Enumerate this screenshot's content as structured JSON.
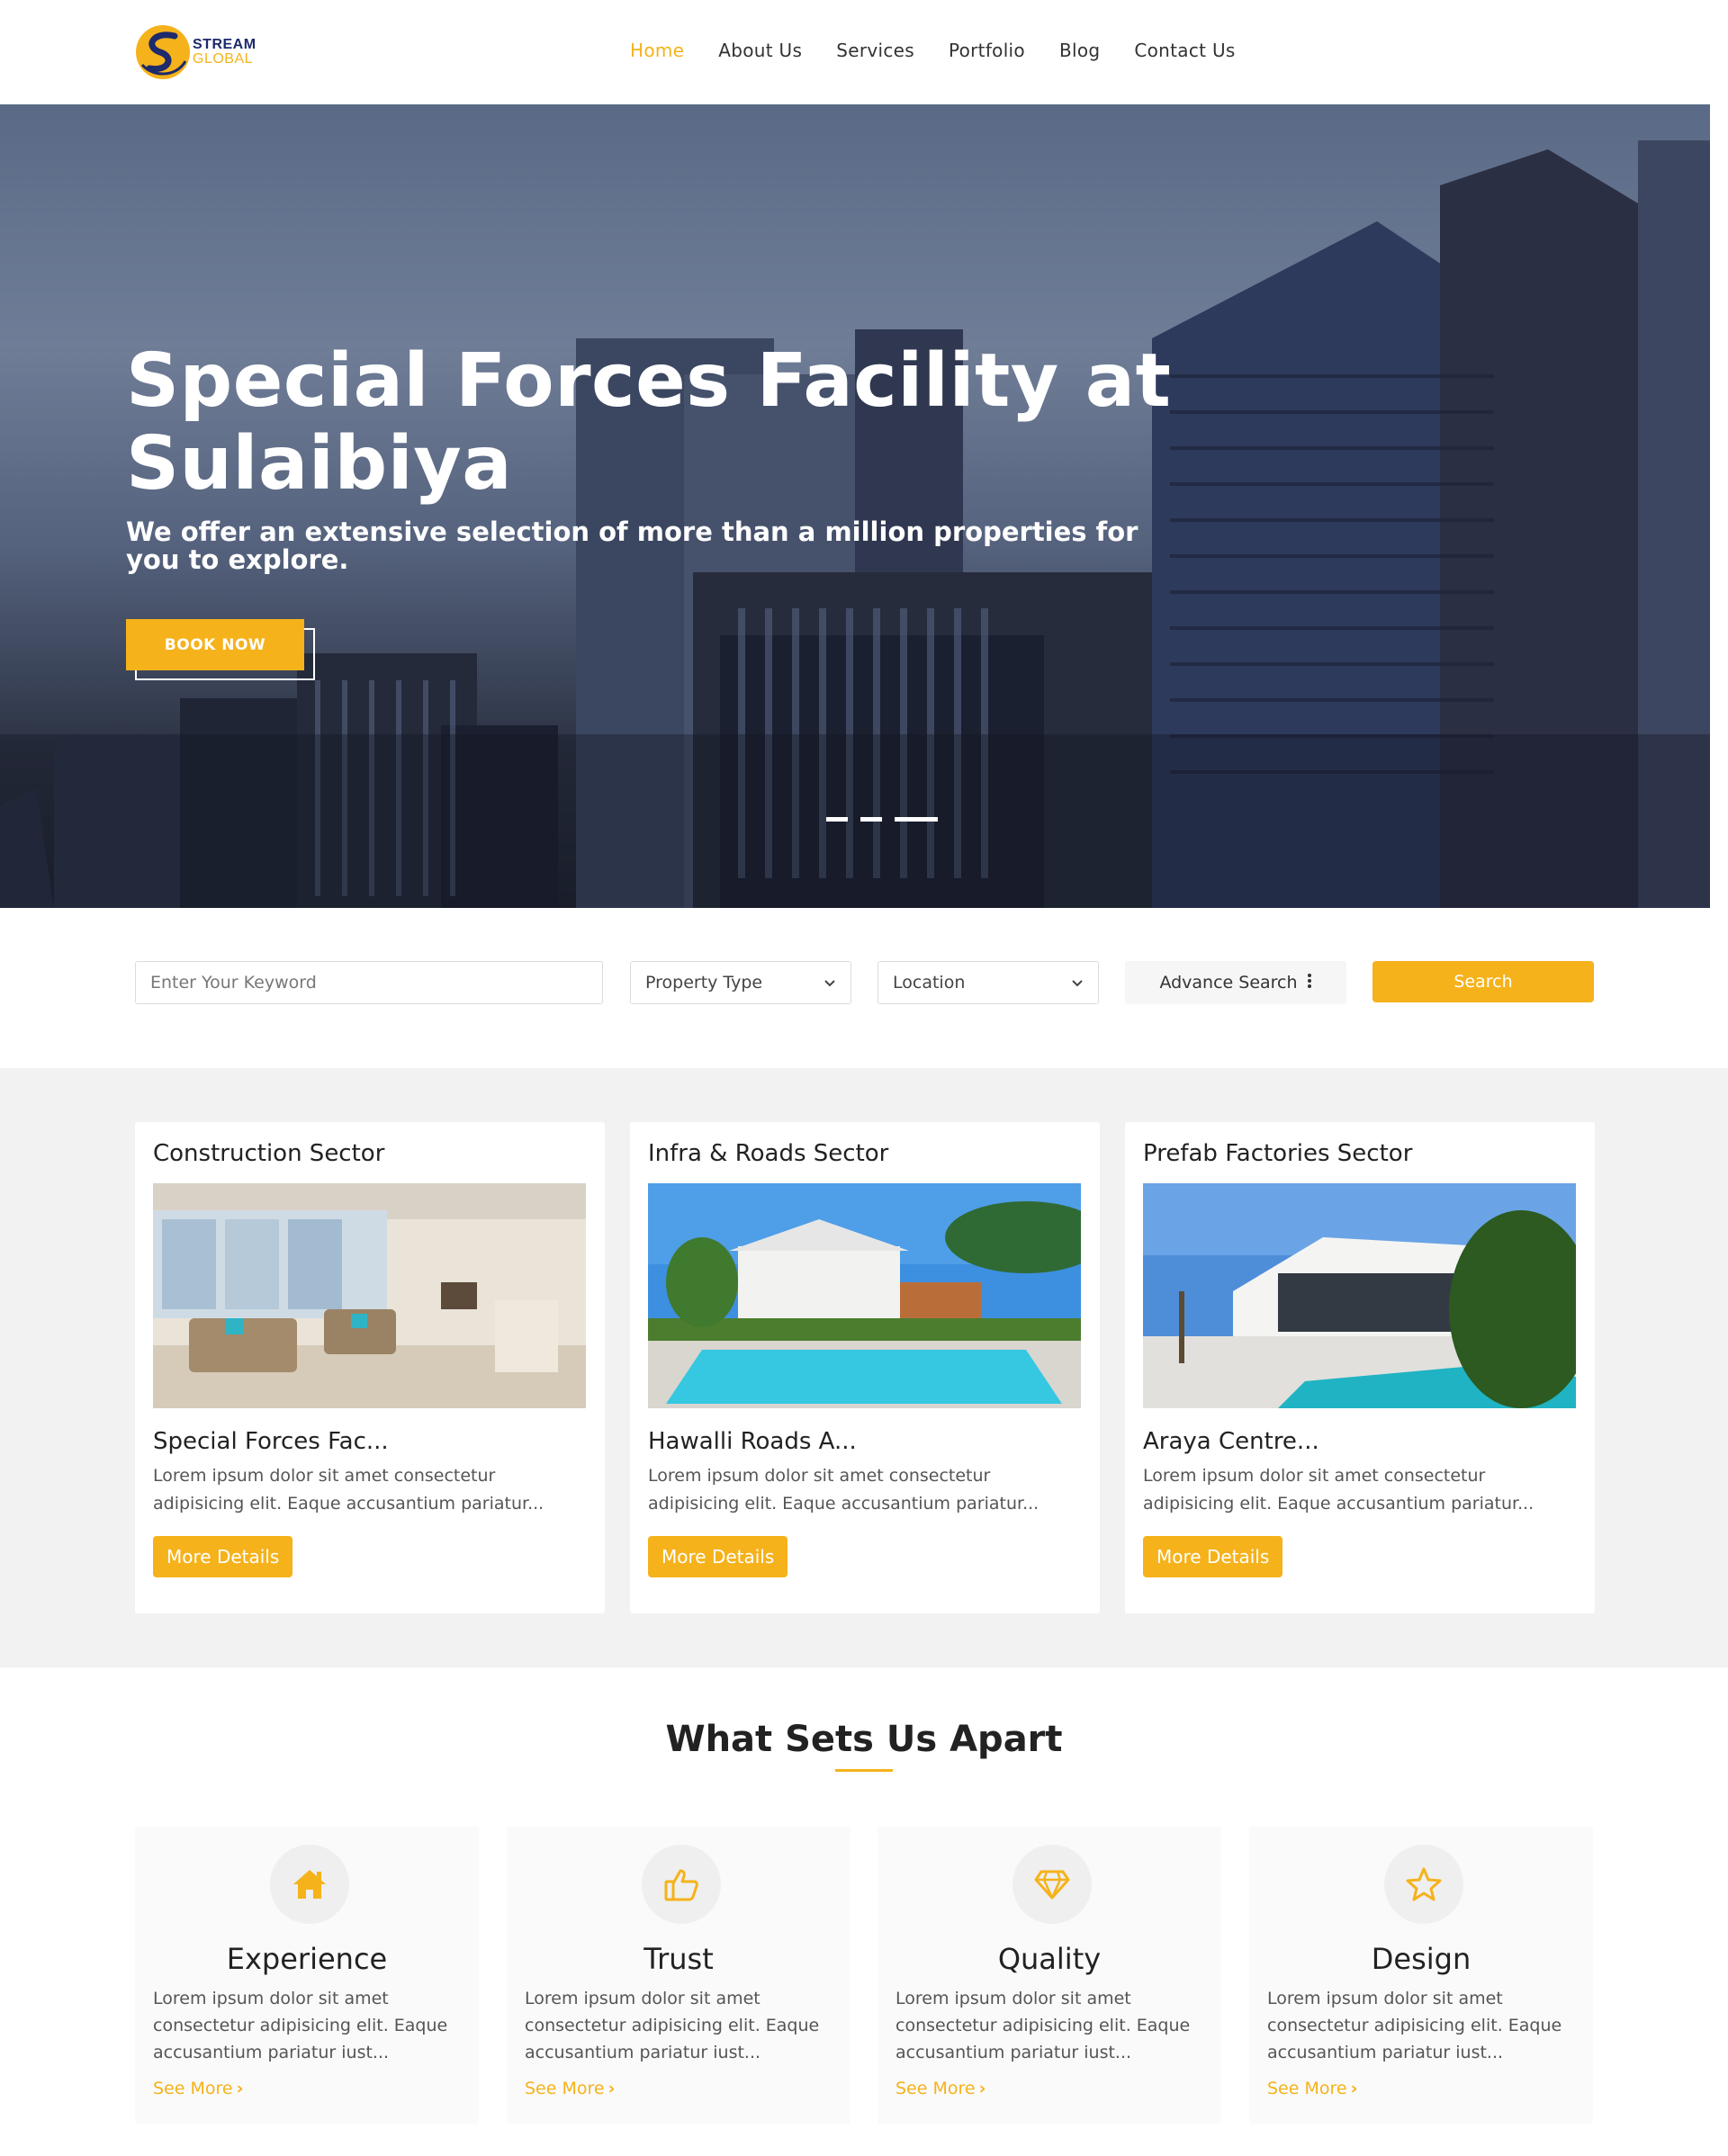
{
  "brand": {
    "line1": "STREAM",
    "line2": "GLOBAL"
  },
  "nav": {
    "items": [
      {
        "label": "Home",
        "active": true
      },
      {
        "label": "About Us"
      },
      {
        "label": "Services"
      },
      {
        "label": "Portfolio"
      },
      {
        "label": "Blog"
      },
      {
        "label": "Contact Us"
      }
    ]
  },
  "hero": {
    "title": "Special Forces Facility at Sulaibiya",
    "subtitle": "We offer an extensive selection of more than a million properties for you to explore.",
    "button": "BOOK NOW",
    "slides": 3,
    "active_slide": 3
  },
  "search": {
    "keyword_placeholder": "Enter Your Keyword",
    "property_type": "Property Type",
    "location": "Location",
    "advance": "Advance Search",
    "button": "Search"
  },
  "sectors": [
    {
      "title": "Construction Sector",
      "name": "Special Forces Fac...",
      "desc": "Lorem ipsum dolor sit amet consectetur adipisicing elit. Eaque accusantium pariatur...",
      "button": "More Details"
    },
    {
      "title": "Infra & Roads Sector",
      "name": "Hawalli Roads A...",
      "desc": "Lorem ipsum dolor sit amet consectetur adipisicing elit. Eaque accusantium pariatur...",
      "button": "More Details"
    },
    {
      "title": "Prefab Factories Sector",
      "name": "Araya Centre...",
      "desc": "Lorem ipsum dolor sit amet consectetur adipisicing elit. Eaque accusantium pariatur...",
      "button": "More Details"
    }
  ],
  "apart": {
    "title": "What Sets Us Apart",
    "features": [
      {
        "title": "Experience",
        "icon": "home-icon",
        "desc": "Lorem ipsum dolor sit amet consectetur adipisicing elit. Eaque accusantium pariatur iust...",
        "link": "See More"
      },
      {
        "title": "Trust",
        "icon": "thumbs-up-icon",
        "desc": "Lorem ipsum dolor sit amet consectetur adipisicing elit. Eaque accusantium pariatur iust...",
        "link": "See More"
      },
      {
        "title": "Quality",
        "icon": "diamond-icon",
        "desc": "Lorem ipsum dolor sit amet consectetur adipisicing elit. Eaque accusantium pariatur iust...",
        "link": "See More"
      },
      {
        "title": "Design",
        "icon": "star-icon",
        "desc": "Lorem ipsum dolor sit amet consectetur adipisicing elit. Eaque accusantium pariatur iust...",
        "link": "See More"
      }
    ]
  },
  "colors": {
    "accent": "#f5b21b",
    "brand_navy": "#1d2a6b"
  }
}
